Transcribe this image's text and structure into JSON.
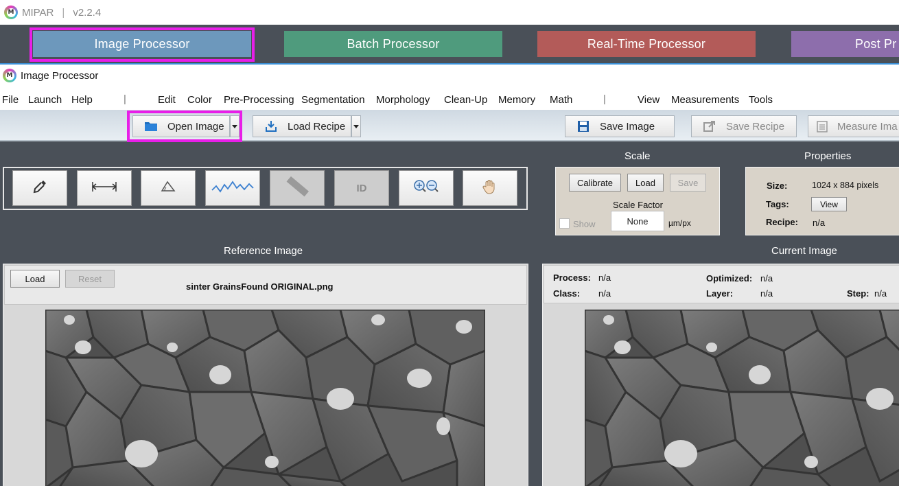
{
  "app": {
    "name": "MIPAR",
    "separator": "|",
    "version": "v2.2.4"
  },
  "modules": [
    {
      "label": "Image Processor",
      "color": "#6b95b8",
      "active": true
    },
    {
      "label": "Batch Processor",
      "color": "#4e9a7c"
    },
    {
      "label": "Real-Time Processor",
      "color": "#b55a58"
    },
    {
      "label": "Post Pr",
      "color": "#8a6aa8"
    }
  ],
  "window": {
    "title": "Image Processor"
  },
  "menu": {
    "left": [
      "File",
      "Launch",
      "Help"
    ],
    "middle": [
      "Edit",
      "Color",
      "Pre-Processing",
      "Segmentation",
      "Morphology",
      "Clean-Up",
      "Memory",
      "Math"
    ],
    "right": [
      "View",
      "Measurements",
      "Tools"
    ],
    "pipe": "|"
  },
  "toolbar": {
    "open_image": "Open Image",
    "load_recipe": "Load Recipe",
    "save_image": "Save Image",
    "save_recipe": "Save Recipe",
    "measure_image": "Measure Ima"
  },
  "tools": [
    {
      "icon": "eyedropper-icon"
    },
    {
      "icon": "measure-line-icon"
    },
    {
      "icon": "angle-icon"
    },
    {
      "icon": "line-profile-icon"
    },
    {
      "icon": "ruler-icon",
      "disabled": true
    },
    {
      "icon": "id-icon",
      "label": "ID",
      "disabled": true
    },
    {
      "icon": "zoom-icon"
    },
    {
      "icon": "pan-hand-icon"
    }
  ],
  "scale": {
    "title": "Scale",
    "calibrate": "Calibrate",
    "load": "Load",
    "save": "Save",
    "scale_factor_label": "Scale Factor",
    "show_label": "Show",
    "value": "None",
    "unit": "µm/px"
  },
  "properties": {
    "title": "Properties",
    "size_label": "Size:",
    "size_value": "1024 x 884 pixels",
    "tags_label": "Tags:",
    "view_button": "View",
    "recipe_label": "Recipe:",
    "recipe_value": "n/a"
  },
  "reference": {
    "title": "Reference Image",
    "load": "Load",
    "reset": "Reset",
    "filename": "sinter GrainsFound ORIGINAL.png"
  },
  "current": {
    "title": "Current Image",
    "process_label": "Process:",
    "process_value": "n/a",
    "class_label": "Class:",
    "class_value": "n/a",
    "optimized_label": "Optimized:",
    "optimized_value": "n/a",
    "layer_label": "Layer:",
    "layer_value": "n/a",
    "step_label": "Step:",
    "step_value": "n/a"
  }
}
